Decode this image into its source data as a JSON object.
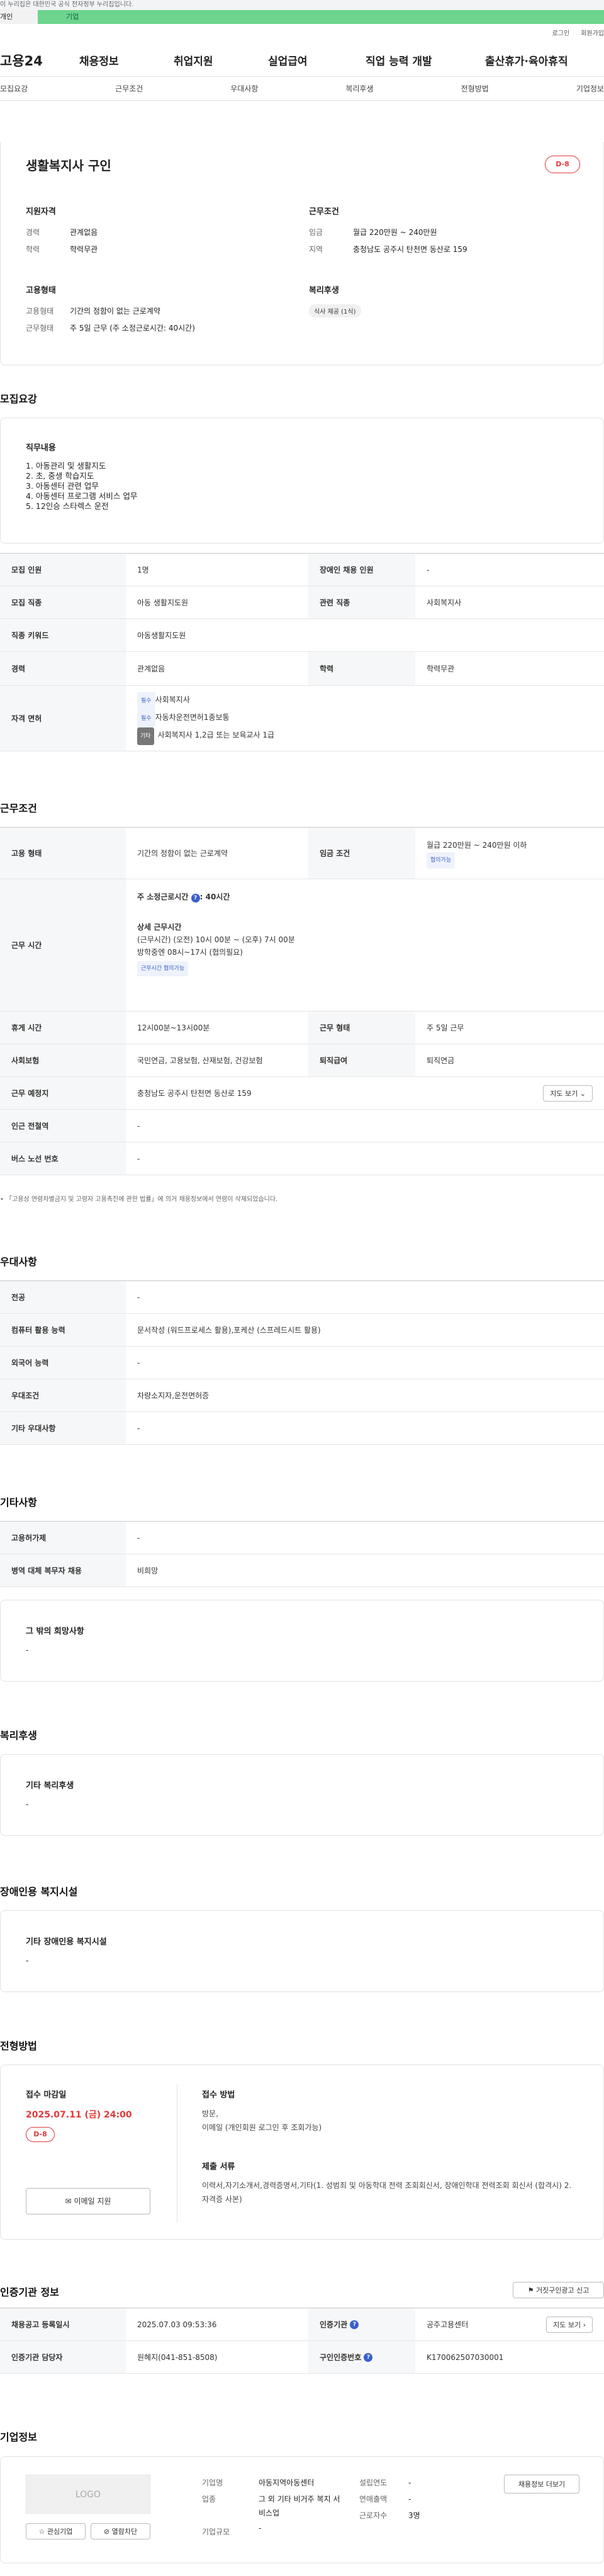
{
  "gov_bar": "이 누리집은 대한민국 공식 전자정부 누리집입니다.",
  "top_tabs": [
    "개인",
    "기업"
  ],
  "util": [
    "로그인",
    "회원가입"
  ],
  "gnb": {
    "logo": "고용24",
    "items": [
      "채용정보",
      "취업지원",
      "실업급여",
      "직업 능력 개발",
      "출산휴가·육아휴직"
    ]
  },
  "subnav": [
    "모집요강",
    "근무조건",
    "우대사항",
    "복리후생",
    "전형방법",
    "기업정보"
  ],
  "header": {
    "title": "생활복지사 구인",
    "dday": "D-8",
    "qual_title": "지원자격",
    "career_k": "경력",
    "career_v": "관계없음",
    "edu_k": "학력",
    "edu_v": "학력무관",
    "work_title": "근무조건",
    "wage_k": "임금",
    "wage_v": "월급 220만원 ~ 240만원",
    "region_k": "지역",
    "region_v": "충청남도 공주시 탄천면 동산로 159",
    "emp_title": "고용형태",
    "emptype_k": "고용형태",
    "emptype_v": "기간의 정함이 없는 근로계약",
    "workform_k": "근무형태",
    "workform_v": "주 5일 근무 (주 소정근로시간: 40시간)",
    "welfare_title": "복리후생",
    "welfare_chip": "식사 제공 (1식)"
  },
  "recruit": {
    "title": "모집요강",
    "duty_title": "직무내용",
    "duties": [
      "1. 아동관리 및 생활지도",
      "2. 초, 중생 학습지도",
      "3. 아동센터 관련 업무",
      "4. 아동센터 프로그램 서비스 업무",
      "5. 12인승 스타렉스 운전"
    ],
    "rows": {
      "headcount_k": "모집 인원",
      "headcount_v": "1명",
      "disabled_k": "장애인 채용 인원",
      "disabled_v": "-",
      "job_k": "모집 직종",
      "job_v": "아동 생활지도원",
      "related_k": "관련 직종",
      "related_v": "사회복지사",
      "keyword_k": "직종 키워드",
      "keyword_v": "아동생활지도원",
      "career_k": "경력",
      "career_v": "관계없음",
      "edu_k": "학력",
      "edu_v": "학력무관",
      "license_k": "자격 면허",
      "lic": [
        {
          "tag": "필수",
          "name": "사회복지사"
        },
        {
          "tag": "필수",
          "name": "자동차운전면허1종보통"
        },
        {
          "tag": "기타",
          "name": "사회복지사 1,2급 또는 보육교사 1급"
        }
      ]
    }
  },
  "cond": {
    "title": "근무조건",
    "emptype_k": "고용 형태",
    "emptype_v": "기간의 정함이 없는 근로계약",
    "wage_k": "임금 조건",
    "wage_v": "월급 220만원 ~ 240만원 이하",
    "wage_chip": "협의가능",
    "hours_k": "근무 시간",
    "hours_head": "주 소정근로시간",
    "hours_val": "40시간",
    "detail_title": "상세 근무시간",
    "detail_1": "(근무시간) (오전) 10시 00분 ~ (오후) 7시 00분",
    "detail_2": "방학중엔 08시~17시 (협의필요)",
    "hours_chip": "근무시간 협의가능",
    "break_k": "휴게 시간",
    "break_v": "12시00분~13시00분",
    "form_k": "근무 형태",
    "form_v": "주 5일 근무",
    "ins_k": "사회보험",
    "ins_v": "국민연금, 고용보험, 산재보험, 건강보험",
    "retire_k": "퇴직급여",
    "retire_v": "퇴직연금",
    "place_k": "근무 예정지",
    "place_v": "충청남도 공주시 탄천면 동산로 159",
    "map_btn": "지도 보기",
    "subway_k": "인근 전철역",
    "subway_v": "-",
    "bus_k": "버스 노선 번호",
    "bus_v": "-",
    "note": "「고용상 연령차별금지 및 고령자 고용촉진에 관한 법률」에 의거 채용정보에서 연령이 삭제되었습니다."
  },
  "pref": {
    "title": "우대사항",
    "major_k": "전공",
    "major_v": "-",
    "pc_k": "컴퓨터 활용 능력",
    "pc_v": "문서작성 (워드프로세스 활용),포케산 (스프레드시트 활용)",
    "lang_k": "외국어 능력",
    "lang_v": "-",
    "cond_k": "우대조건",
    "cond_v": "차량소지자,운전면허증",
    "etc_k": "기타 우대사항",
    "etc_v": "-"
  },
  "other": {
    "title": "기타사항",
    "hire_k": "고용허가제",
    "hire_v": "-",
    "mil_k": "병역 대체 복무자 채용",
    "mil_v": "비희망",
    "wish_title": "그 밖의 희망사항",
    "wish_v": "-"
  },
  "welfare": {
    "title": "복리후생",
    "sub": "기타 복리후생",
    "val": "-"
  },
  "disabled_fac": {
    "title": "장애인용 복지시설",
    "sub": "기타 장애인용 복지시설",
    "val": "-"
  },
  "process": {
    "title": "전형방법",
    "deadline_title": "접수 마감일",
    "deadline": "2025.07.11 (금) 24:00",
    "dday": "D-8",
    "apply_btn": "이메일 지원",
    "method_title": "접수 방법",
    "method_1": "방문,",
    "method_2": "이메일 (개인회원 로그인 후 조회가능)",
    "docs_title": "제출 서류",
    "docs": "이력서,자기소개서,경력증명서,기타(1. 성범죄 및 아동학대 전력 조회회신서, 장애인학대 전력조회 회신서 (합격시) 2. 자격증 사본)"
  },
  "cert": {
    "title": "인증기관 정보",
    "report_btn": "거짓구인광고 신고",
    "reg_k": "채용공고 등록일시",
    "reg_v": "2025.07.03 09:53:36",
    "org_k": "인증기관",
    "org_v": "공주고용센터",
    "map_btn": "지도 보기",
    "mgr_k": "인증기관 담당자",
    "mgr_v": "원혜지(041-851-8508)",
    "num_k": "구인인증번호",
    "num_v": "K170062507030001"
  },
  "company": {
    "title": "기업정보",
    "logo": "LOGO",
    "fav_btn": "관심기업",
    "block_btn": "열람차단",
    "info_btn": "채용정보 더보기",
    "name_k": "기업명",
    "name_v": "아동지역아동센터",
    "ind_k": "업종",
    "ind_v": "그 외 기타 비거주 복지 서비스업",
    "scale_k": "기업규모",
    "scale_v": "-",
    "est_k": "설립연도",
    "est_v": "-",
    "sales_k": "연매출액",
    "sales_v": "-",
    "emp_k": "근로자수",
    "emp_v": "3명"
  },
  "colors": {
    "accent": "#6cd48c",
    "red": "#e5383b",
    "blue": "#3a61c9"
  }
}
